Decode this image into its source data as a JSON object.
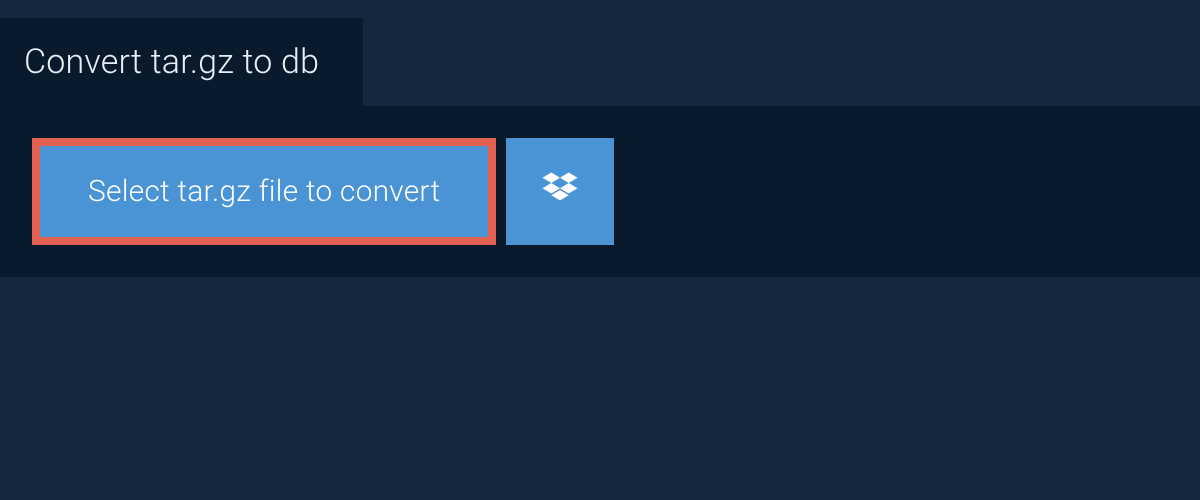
{
  "header": {
    "title": "Convert tar.gz to db"
  },
  "actions": {
    "select_file_label": "Select tar.gz file to convert"
  },
  "colors": {
    "page_bg": "#14273d",
    "panel_bg": "#0a1a2d",
    "button_bg": "#4a94d6",
    "highlight_border": "#e26052",
    "text_light": "#ffffff"
  }
}
